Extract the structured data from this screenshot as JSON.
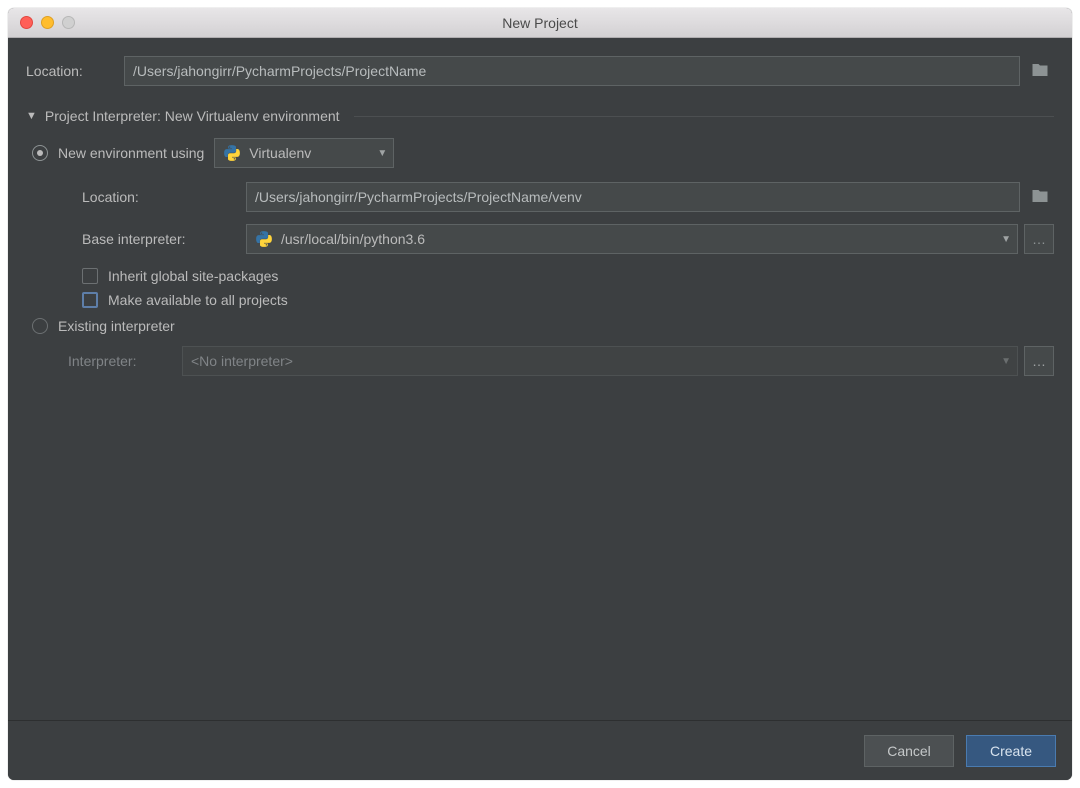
{
  "window": {
    "title": "New Project"
  },
  "location": {
    "label": "Location:",
    "value": "/Users/jahongirr/PycharmProjects/ProjectName"
  },
  "interpreter_section": {
    "header": "Project Interpreter: New Virtualenv environment",
    "new_env": {
      "radio_label": "New environment using",
      "tool": "Virtualenv",
      "location_label": "Location:",
      "location_value": "/Users/jahongirr/PycharmProjects/ProjectName/venv",
      "base_label": "Base interpreter:",
      "base_value": "/usr/local/bin/python3.6",
      "inherit_label": "Inherit global site-packages",
      "available_label": "Make available to all projects"
    },
    "existing": {
      "radio_label": "Existing interpreter",
      "interpreter_label": "Interpreter:",
      "interpreter_value": "<No interpreter>"
    }
  },
  "buttons": {
    "cancel": "Cancel",
    "create": "Create"
  }
}
